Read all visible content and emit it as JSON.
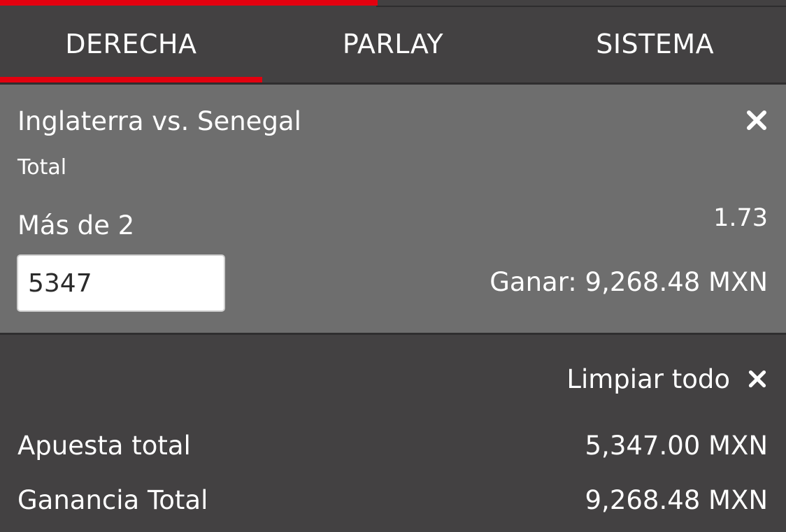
{
  "progress": {
    "fraction": 0.48,
    "color": "#e3000f"
  },
  "tabs": [
    {
      "label": "DERECHA",
      "active": true
    },
    {
      "label": "PARLAY",
      "active": false
    },
    {
      "label": "SISTEMA",
      "active": false
    }
  ],
  "bet": {
    "event": "Inglaterra vs. Senegal",
    "market": "Total",
    "selection": "Más de 2",
    "odds": "1.73",
    "stake": "5347",
    "to_win": "Ganar: 9,268.48 MXN",
    "remove_icon": "close-icon"
  },
  "actions": {
    "clear_all_label": "Limpiar todo",
    "clear_all_icon": "close-icon"
  },
  "summary": {
    "total_stake_label": "Apuesta total",
    "total_stake_value": "5,347.00 MXN",
    "total_win_label": "Ganancia Total",
    "total_win_value": "9,268.48 MXN"
  },
  "colors": {
    "accent": "#e3000f",
    "background": "#434142",
    "card": "#6e6e6e"
  }
}
